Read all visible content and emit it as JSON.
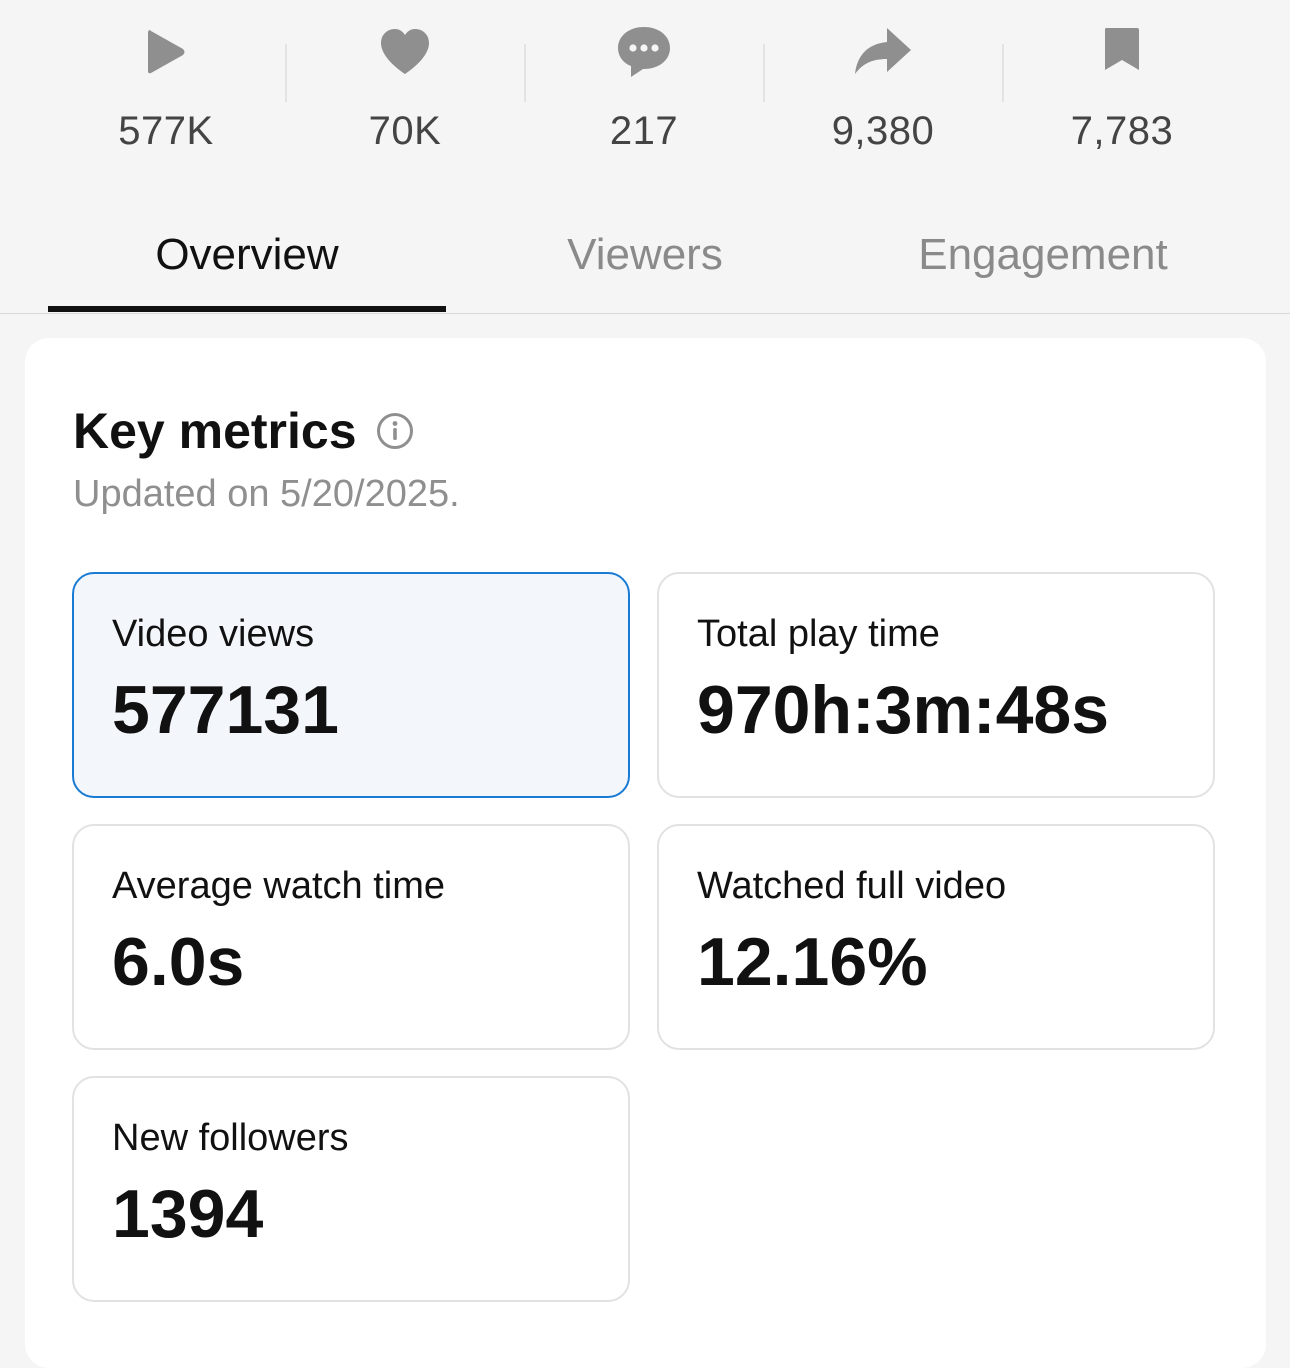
{
  "stats": [
    {
      "icon": "play-icon",
      "value": "577K"
    },
    {
      "icon": "heart-icon",
      "value": "70K"
    },
    {
      "icon": "comment-icon",
      "value": "217"
    },
    {
      "icon": "share-icon",
      "value": "9,380"
    },
    {
      "icon": "bookmark-icon",
      "value": "7,783"
    }
  ],
  "tabs": [
    {
      "label": "Overview",
      "active": true
    },
    {
      "label": "Viewers",
      "active": false
    },
    {
      "label": "Engagement",
      "active": false
    }
  ],
  "key_metrics": {
    "title": "Key metrics",
    "updated": "Updated on 5/20/2025.",
    "items": [
      {
        "label": "Video views",
        "value": "577131",
        "selected": true
      },
      {
        "label": "Total play time",
        "value": "970h:3m:48s",
        "selected": false
      },
      {
        "label": "Average watch time",
        "value": "6.0s",
        "selected": false
      },
      {
        "label": "Watched full video",
        "value": "12.16%",
        "selected": false
      },
      {
        "label": "New followers",
        "value": "1394",
        "selected": false
      }
    ]
  },
  "colors": {
    "icon": "#8f8f8f",
    "selected_border": "#1a7bd4",
    "selected_bg": "#f3f7fc"
  }
}
